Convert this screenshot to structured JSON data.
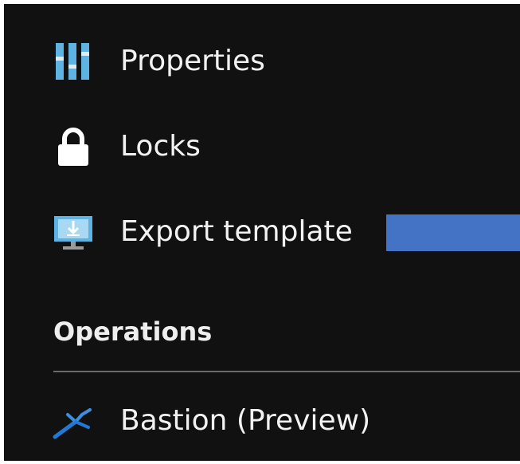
{
  "menu": {
    "items": [
      {
        "label": "Properties",
        "icon": "properties-icon"
      },
      {
        "label": "Locks",
        "icon": "lock-icon"
      },
      {
        "label": "Export template",
        "icon": "export-template-icon"
      }
    ]
  },
  "operations": {
    "header": "Operations",
    "items": [
      {
        "label": "Bastion (Preview)",
        "icon": "bastion-icon"
      }
    ]
  },
  "colors": {
    "background": "#111111",
    "text": "#f2f2f2",
    "highlight": "#4472c4",
    "divider": "#6a6a6a",
    "icon_blue": "#5fb3e3",
    "bastion_blue": "#1f7ad6"
  }
}
